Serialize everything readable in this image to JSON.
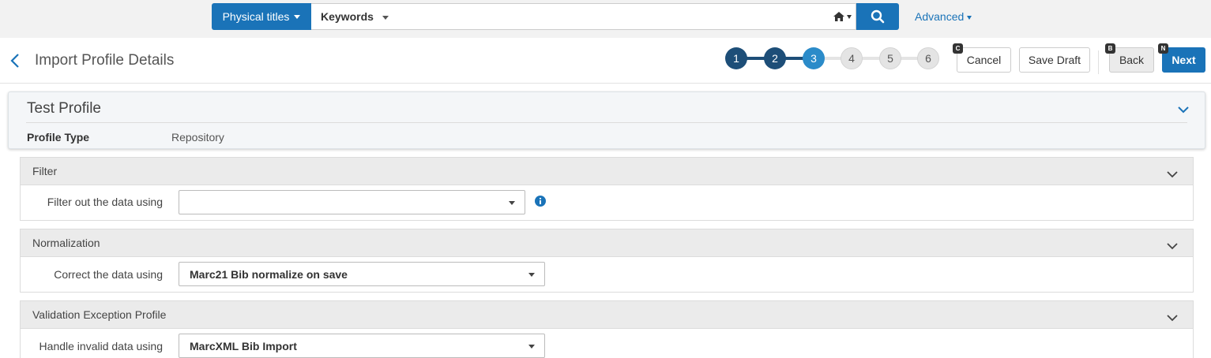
{
  "search": {
    "scope_label": "Physical titles",
    "field_label": "Keywords",
    "advanced_label": "Advanced"
  },
  "header": {
    "title": "Import Profile Details",
    "steps": [
      {
        "label": "1",
        "state": "done"
      },
      {
        "label": "2",
        "state": "done"
      },
      {
        "label": "3",
        "state": "current"
      },
      {
        "label": "4",
        "state": "todo"
      },
      {
        "label": "5",
        "state": "todo"
      },
      {
        "label": "6",
        "state": "todo"
      }
    ],
    "cancel_label": "Cancel",
    "cancel_key": "C",
    "save_draft_label": "Save Draft",
    "back_label": "Back",
    "back_key": "B",
    "next_label": "Next",
    "next_key": "N"
  },
  "profile": {
    "name": "Test Profile",
    "type_label": "Profile Type",
    "type_value": "Repository"
  },
  "sections": {
    "filter": {
      "title": "Filter",
      "field_label": "Filter out the data using",
      "value": ""
    },
    "normalization": {
      "title": "Normalization",
      "field_label": "Correct the data using",
      "value": "Marc21 Bib normalize on save"
    },
    "validation": {
      "title": "Validation Exception Profile",
      "field_label": "Handle invalid data using",
      "value": "MarcXML Bib Import"
    }
  },
  "colors": {
    "primary": "#1a73b8",
    "step_done": "#1d4e78",
    "step_current": "#2b8bc9",
    "step_todo": "#e4e4e4"
  }
}
